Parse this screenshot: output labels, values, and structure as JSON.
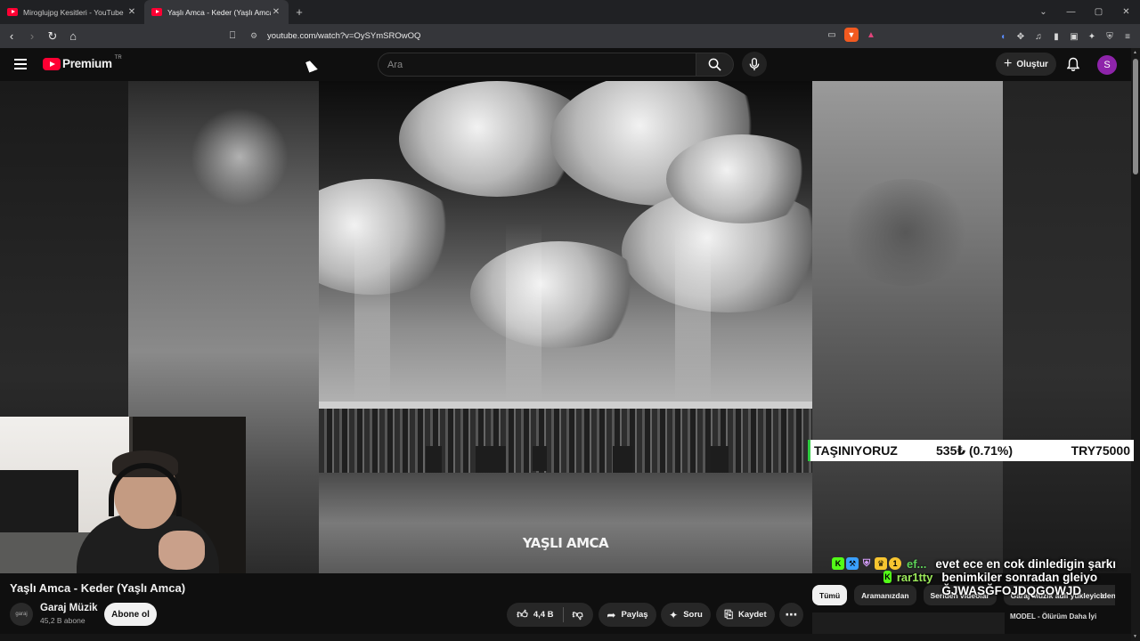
{
  "browser": {
    "tabs": [
      {
        "title": "Miroglujpg Kesitleri - YouTube",
        "active": false
      },
      {
        "title": "Yaşlı Amca - Keder (Yaşlı Amca)",
        "active": true
      }
    ],
    "new_tab": "+",
    "url": "youtube.com/watch?v=OySYmSROwOQ",
    "window_controls": {
      "chevron": "⌄",
      "minimize": "—",
      "maximize": "▢",
      "close": "✕"
    }
  },
  "youtube": {
    "logo_text": "Premium",
    "country_code": "TR",
    "search_placeholder": "Ara",
    "create_label": "Oluştur",
    "avatar_letter": "S"
  },
  "video": {
    "art_title": "YAŞLI AMCA",
    "title": "Yaşlı Amca - Keder (Yaşlı Amca)",
    "channel_name": "Garaj Müzik",
    "channel_avatar_text": "garaj",
    "subscribers": "45,2 B abone",
    "subscribe_label": "Abone ol",
    "likes": "4,4 B",
    "share_label": "Paylaş",
    "ask_label": "Soru",
    "save_label": "Kaydet",
    "more_label": "⋯"
  },
  "ticker": {
    "label": "TAŞINIYORUZ",
    "change": "535₺ (0.71%)",
    "total": "TRY75000"
  },
  "chat": [
    {
      "name": "ef...",
      "message": "evet ece en cok dinledigin şarkı",
      "badges": [
        "K",
        "⚒",
        "⛨",
        "♛",
        "1"
      ]
    },
    {
      "name": "rar1tty",
      "message": "benimkiler sonradan gleiyo ĞJWASĞFOJDQGOWJD",
      "badges": [
        "K"
      ]
    }
  ],
  "chips": [
    "Tümü",
    "Aramanızdan",
    "Seriden videolar",
    "Garaj Müzik adlı yükleyiciden"
  ],
  "recommended_partial": "MODEL - Ölürüm Daha İyi",
  "colors": {
    "yt_red": "#ff0033",
    "avatar_purple": "#8e24aa",
    "kick_green": "#53fc18",
    "background": "#0f0f0f"
  }
}
